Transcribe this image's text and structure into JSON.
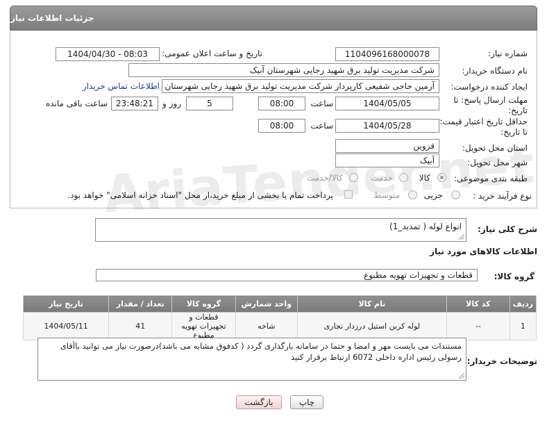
{
  "header": {
    "title": "جزئیات اطلاعات نیاز"
  },
  "watermark": {
    "text": "AriaTender.net"
  },
  "fields": {
    "need_number_label": "شماره نیاز:",
    "need_number": "1104096168000078",
    "announce_label": "تاریخ و ساعت اعلان عمومی:",
    "announce_value": "1404/04/30 - 08:03",
    "buyer_org_label": "نام دستگاه خریدار:",
    "buyer_org": "شرکت مدیریت تولید برق شهید رجایی شهرستان آبیک",
    "requester_label": "ایجاد کننده درخواست:",
    "requester": "آرمین حاجی شفیعی کارپرداز شرکت مدیریت تولید برق شهید رجایی شهرستان",
    "buyer_contact_link": "اطلاعات تماس خریدار",
    "deadline_label_1": "مهلت ارسال پاسخ: تا",
    "deadline_label_2": "تاریخ:",
    "deadline_date": "1404/05/05",
    "time_label": "ساعت",
    "deadline_time": "08:00",
    "days_value": "5",
    "days_label": "روز و",
    "remaining_time": "23:48:21",
    "remaining_label": "ساعت باقی مانده",
    "price_validity_label_1": "حداقل تاریخ اعتبار قیمت:",
    "price_validity_label_2": "تا تاریخ:",
    "price_validity_date": "1404/05/28",
    "price_validity_time": "08:00",
    "province_label": "استان محل تحویل:",
    "province": "قزوین",
    "city_label": "شهر محل تحویل:",
    "city": "آبیک",
    "category_label": "طبقه بندی موضوعی:",
    "category_goods": "کالا",
    "category_service": "خدمت",
    "category_goods_service": "کالا/خدمت",
    "process_label": "نوع فرآیند خرید :",
    "process_partial": "جزیی",
    "process_medium": "متوسط",
    "payment_note": "پرداخت تمام یا بخشی از مبلغ خرید،از محل \"اسناد خزانه اسلامی\" خواهد بود."
  },
  "summary": {
    "label": "شرح کلی نیاز:",
    "value": "انواع لوله ( تمدید_1)"
  },
  "goods_section_title": "اطلاعات کالاهای مورد نیاز",
  "goods_group": {
    "label": "گروه کالا:",
    "value": "قطعات و تجهیزات تهویه مطبوع"
  },
  "table": {
    "headers": [
      "ردیف",
      "کد کالا",
      "نام کالا",
      "واحد شمارش",
      "گروه کالا",
      "تعداد / مقدار",
      "تاریخ نیاز"
    ],
    "rows": [
      [
        "1",
        "--",
        "لوله کربن استیل درزدار تجاری",
        "شاخه",
        "قطعات و تجهیزات تهویه مطبوع",
        "41",
        "1404/05/11"
      ]
    ]
  },
  "buyer_notes": {
    "label": "توضیحات خریدار:",
    "line1": "مستندات می بایست مهر و امضا و حتما در سامانه بارگذاری گردد ( کدفوق مشابه می باشد)درصورت نیاز می توانید باآقای",
    "line2": "رسولی رئیس اداره  داخلی 6072 ارتباط برقرار کنید"
  },
  "buttons": {
    "print": "چاپ",
    "back": "بازگشت"
  }
}
